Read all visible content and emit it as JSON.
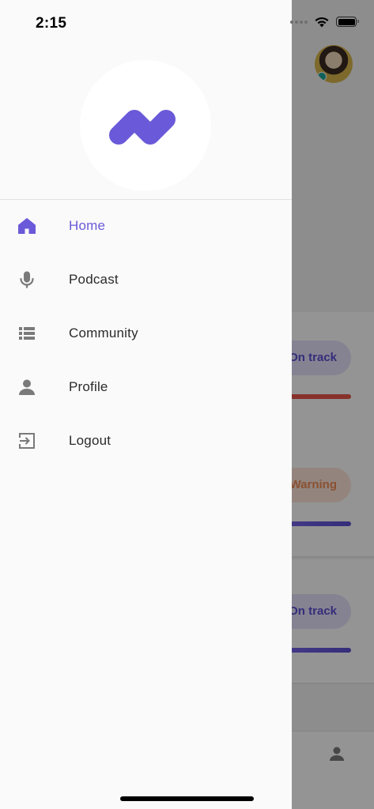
{
  "status_bar": {
    "time": "2:15",
    "icons": [
      "cellular-dots-icon",
      "wifi-icon",
      "battery-icon"
    ]
  },
  "drawer": {
    "logo": "app-logo-icon",
    "menu": [
      {
        "label": "Home",
        "icon": "home-icon",
        "active": true
      },
      {
        "label": "Podcast",
        "icon": "microphone-icon",
        "active": false
      },
      {
        "label": "Community",
        "icon": "list-icon",
        "active": false
      },
      {
        "label": "Profile",
        "icon": "person-icon",
        "active": false
      },
      {
        "label": "Logout",
        "icon": "logout-icon",
        "active": false
      }
    ]
  },
  "background": {
    "cards": [
      {
        "status": "On track",
        "bar_color": "#e8574b"
      },
      {
        "status": "Warning",
        "bar_color": "#7b68ee"
      },
      {
        "status": "On track",
        "bar_color": "#7b68ee"
      }
    ],
    "tabbar": {
      "icon": "person-icon"
    }
  },
  "colors": {
    "accent": "#6a5ad9",
    "icon_gray": "#7a7a7a",
    "drawer_bg": "#fafafa",
    "warning": "#ef8a55"
  }
}
